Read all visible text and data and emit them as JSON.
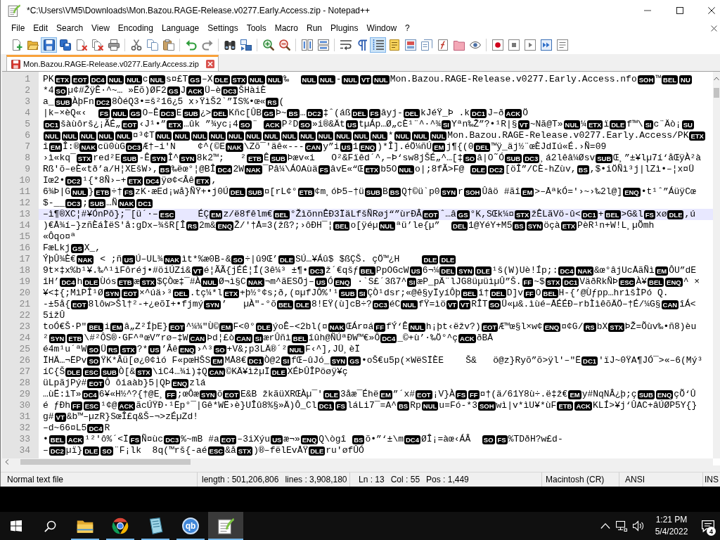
{
  "window": {
    "title": "*C:\\Users\\VM5\\Downloads\\Mon.Bazou.RAGE-Release.v0277.Early.Access.zip - Notepad++"
  },
  "menu": [
    "File",
    "Edit",
    "Search",
    "View",
    "Encoding",
    "Language",
    "Settings",
    "Tools",
    "Macro",
    "Run",
    "Plugins",
    "Window",
    "?"
  ],
  "toolbar": [
    {
      "buttons": [
        {
          "kind": "new",
          "pressed": false
        },
        {
          "kind": "open",
          "pressed": false
        },
        {
          "kind": "save",
          "pressed": true
        },
        {
          "kind": "saveall",
          "pressed": false
        },
        {
          "kind": "close",
          "pressed": false
        },
        {
          "kind": "closeall",
          "pressed": false
        },
        {
          "kind": "print",
          "pressed": false
        }
      ]
    },
    {
      "buttons": [
        {
          "kind": "cut",
          "pressed": false
        },
        {
          "kind": "copy",
          "pressed": false
        },
        {
          "kind": "paste",
          "pressed": false
        }
      ]
    },
    {
      "buttons": [
        {
          "kind": "undo",
          "pressed": false
        },
        {
          "kind": "redo",
          "pressed": false
        }
      ]
    },
    {
      "buttons": [
        {
          "kind": "find",
          "pressed": false
        },
        {
          "kind": "replace",
          "pressed": false
        }
      ]
    },
    {
      "buttons": [
        {
          "kind": "zoomin",
          "pressed": false
        },
        {
          "kind": "zoomout",
          "pressed": false
        }
      ]
    },
    {
      "buttons": [
        {
          "kind": "syncv",
          "pressed": false
        },
        {
          "kind": "synch",
          "pressed": false
        }
      ]
    },
    {
      "buttons": [
        {
          "kind": "wrap",
          "pressed": false
        },
        {
          "kind": "allchars",
          "pressed": false
        },
        {
          "kind": "indent",
          "pressed": true
        },
        {
          "kind": "udl",
          "pressed": false
        },
        {
          "kind": "docmap",
          "pressed": false
        },
        {
          "kind": "doclist",
          "pressed": false
        },
        {
          "kind": "funclist",
          "pressed": false
        },
        {
          "kind": "workspace",
          "pressed": false
        },
        {
          "kind": "monitor",
          "pressed": false
        }
      ]
    },
    {
      "buttons": [
        {
          "kind": "record",
          "pressed": false
        },
        {
          "kind": "stop",
          "pressed": false
        },
        {
          "kind": "play",
          "pressed": false
        },
        {
          "kind": "playmulti",
          "pressed": false
        },
        {
          "kind": "savemacro",
          "pressed": false
        }
      ]
    }
  ],
  "tabs": [
    {
      "label": "Mon.Bazou.RAGE-Release.v0277.Early.Access.zip",
      "selected": true,
      "modified": true
    }
  ],
  "editor": {
    "lines": [
      {
        "number": "1",
        "selected": false,
        "parts": [
          {
            "text": "PK"
          },
          {
            "control": "ETX"
          },
          {
            "control": "EOT"
          },
          {
            "control": "DC4"
          },
          {
            "control": "NUL"
          },
          {
            "control": "NUL"
          },
          {
            "text": "c"
          },
          {
            "control": "NUL"
          },
          {
            "text": "s¤£T"
          },
          {
            "control": "GS"
          },
          {
            "text": "–X"
          },
          {
            "control": "DLE"
          },
          {
            "control": "STX"
          },
          {
            "control": "NUL"
          },
          {
            "control": "NUL"
          },
          {
            "text": "‰  "
          },
          {
            "control": "NUL"
          },
          {
            "control": "NUL"
          },
          {
            "text": "-"
          },
          {
            "control": "NUL"
          },
          {
            "control": "VT"
          },
          {
            "control": "NUL"
          },
          {
            "text": "Mon.Bazou.RAGE-Release.v0277.Early.Access.nfo"
          },
          {
            "control": "SOH"
          },
          {
            "text": "™"
          },
          {
            "control": "BEL"
          },
          {
            "control": "NU"
          }
        ]
      },
      {
        "number": "2",
        "selected": false,
        "parts": [
          {
            "text": "*4"
          },
          {
            "control": "SO"
          },
          {
            "text": "µ¢#ŽÿÊ·^~… »Ëõ)ØF2"
          },
          {
            "control": "GS"
          },
          {
            "text": "J"
          },
          {
            "control": "ACK"
          },
          {
            "text": "Ü–è"
          },
          {
            "control": "DC3"
          },
          {
            "text": "ŠHàiÈ"
          }
        ]
      },
      {
        "number": "3",
        "selected": false,
        "parts": [
          {
            "text": "a_"
          },
          {
            "control": "SUB"
          },
          {
            "text": "ÀþFn"
          },
          {
            "control": "DC2"
          },
          {
            "text": "8ÒéQ3•=š²16¿5 x›ŸìŠ2`”ÏS%•œ«"
          },
          {
            "control": "RS"
          },
          {
            "text": "("
          }
        ]
      },
      {
        "number": "4",
        "selected": false,
        "parts": [
          {
            "text": "|k–×èQ«‹  "
          },
          {
            "control": "FS"
          },
          {
            "control": "NUL"
          },
          {
            "control": "GS"
          },
          {
            "text": "O–Ê"
          },
          {
            "control": "DC3"
          },
          {
            "text": "E"
          },
          {
            "control": "SUB"
          },
          {
            "text": "¿>"
          },
          {
            "control": "DEL"
          },
          {
            "text": "Kñc[ÛB"
          },
          {
            "control": "GS"
          },
          {
            "text": "Þ~"
          },
          {
            "control": "BS"
          },
          {
            "text": "…"
          },
          {
            "control": "DC2"
          },
          {
            "text": "‡ˆ(áß"
          },
          {
            "control": "DEL"
          },
          {
            "control": "FS"
          },
          {
            "text": "âyj-"
          },
          {
            "control": "DEL"
          },
          {
            "text": "kJéŸ_Þ .k"
          },
          {
            "control": "DC1"
          },
          {
            "text": "J–ð"
          },
          {
            "control": "ACK"
          },
          {
            "text": "Ö"
          }
        ]
      },
      {
        "number": "5",
        "selected": false,
        "parts": [
          {
            "control": "DC1"
          },
          {
            "text": "šàùôrš¿¡ÃÉ„"
          },
          {
            "control": "EOT"
          },
          {
            "text": "‹J¹•”"
          },
          {
            "control": "ETX"
          },
          {
            "text": "…ûk ”¾yc¡4"
          },
          {
            "control": "SO"
          },
          {
            "text": "¨ "
          },
          {
            "control": "ACK"
          },
          {
            "text": "P²D"
          },
          {
            "control": "SO"
          },
          {
            "text": "»i®&Ät"
          },
          {
            "control": "US"
          },
          {
            "text": "tµÁp…Ø„cÈ¹¨^·^¾"
          },
          {
            "control": "SI"
          },
          {
            "text": "Yªn‰Ž”?•¹R|§"
          },
          {
            "control": "VT"
          },
          {
            "text": "~Nã@T»"
          },
          {
            "control": "NUL"
          },
          {
            "text": "¼"
          },
          {
            "control": "ETX"
          },
          {
            "text": "ï"
          },
          {
            "control": "DLE"
          },
          {
            "text": "f™\\"
          },
          {
            "control": "SI"
          },
          {
            "text": "c¨Äò¡"
          },
          {
            "control": "SU"
          }
        ]
      },
      {
        "number": "6",
        "selected": false,
        "parts": [
          {
            "control": "NUL"
          },
          {
            "control": "NUL"
          },
          {
            "control": "NUL"
          },
          {
            "control": "NUL"
          },
          {
            "control": "NUL"
          },
          {
            "text": "¤³¢T"
          },
          {
            "control": "NUL"
          },
          {
            "control": "NUL"
          },
          {
            "control": "NUL"
          },
          {
            "control": "NUL"
          },
          {
            "control": "NUL"
          },
          {
            "control": "NUL"
          },
          {
            "control": "NUL"
          },
          {
            "control": "NUL"
          },
          {
            "control": "NUL"
          },
          {
            "control": "NUL"
          },
          {
            "control": "NUL"
          },
          {
            "control": "NUL"
          },
          {
            "control": "NUL"
          },
          {
            "text": "*"
          },
          {
            "control": "NUL"
          },
          {
            "control": "NUL"
          },
          {
            "control": "NUL"
          },
          {
            "text": "Mon.Bazou.RAGE-Release.v0277.Early.Access/PK"
          },
          {
            "control": "ETX"
          }
        ]
      },
      {
        "number": "7",
        "selected": false,
        "parts": [
          {
            "text": "î"
          },
          {
            "control": "EM"
          },
          {
            "text": "Î:®"
          },
          {
            "control": "NAK"
          },
          {
            "text": "cü0ùG"
          },
          {
            "control": "DC3"
          },
          {
            "text": "Æ†–i'N    ¢^(©E"
          },
          {
            "control": "NAK"
          },
          {
            "text": "\\Zõ¯'äê«---"
          },
          {
            "control": "CAN"
          },
          {
            "text": "y”i"
          },
          {
            "control": "US"
          },
          {
            "text": "1"
          },
          {
            "control": "ENQ"
          },
          {
            "text": ")*Î].éÖ¼ñÚ"
          },
          {
            "control": "EM"
          },
          {
            "text": "j¶{(0"
          },
          {
            "control": "DEL"
          },
          {
            "text": "™ÿ_äj½¨œÈJdIú«É.›Ñ=09"
          }
        ]
      },
      {
        "number": "8",
        "selected": false,
        "parts": [
          {
            "text": "›ì«kq¯"
          },
          {
            "control": "STX"
          },
          {
            "text": "red²E"
          },
          {
            "control": "SUB"
          },
          {
            "text": "-Ê"
          },
          {
            "control": "SYN"
          },
          {
            "text": "Î^"
          },
          {
            "control": "SYN"
          },
          {
            "text": "8k2™;   ²"
          },
          {
            "control": "ETB"
          },
          {
            "text": "Ê"
          },
          {
            "control": "SUB"
          },
          {
            "text": "Þæv«i   O²&Fïêd´^,–Þ‘sw8jŠÉ„^…[‡"
          },
          {
            "control": "SO"
          },
          {
            "text": "â|O˜Ó"
          },
          {
            "control": "SUB"
          },
          {
            "control": "DC3"
          },
          {
            "text": "¸á2lêâ¼Øsv"
          },
          {
            "control": "SUB"
          },
          {
            "text": "Œ¸”±¥lµ7í‘åŒÿÀ²à"
          }
        ]
      },
      {
        "number": "9",
        "selected": false,
        "parts": [
          {
            "text": "Rß'õ–eÈ«tð’a/H¦XEšW›,"
          },
          {
            "control": "BS"
          },
          {
            "text": "‰ëœ°¦@BÎ"
          },
          {
            "control": "DC4"
          },
          {
            "text": "2W"
          },
          {
            "control": "NAK"
          },
          {
            "text": "¯Pâ¼\\ÁOAùä"
          },
          {
            "control": "FS"
          },
          {
            "text": "âvE«“Œ"
          },
          {
            "control": "ETX"
          },
          {
            "text": "b5O"
          },
          {
            "control": "NUL"
          },
          {
            "text": "o|;8fÃ>F@ "
          },
          {
            "control": "DLE"
          },
          {
            "control": "DC2"
          },
          {
            "text": "[öÎ”/CÈ-hZùv,"
          },
          {
            "control": "BS"
          },
          {
            "text": ",$•iÖÑì³j|lZì•–¦x¤Ü"
          }
        ]
      },
      {
        "number": "10",
        "selected": false,
        "parts": [
          {
            "text": "Iœ2•"
          },
          {
            "control": "DC2"
          },
          {
            "text": "¹{*8Ñ›–+"
          },
          {
            "control": "ETX"
          },
          {
            "control": "DC4"
          },
          {
            "text": "ÿø¢<Âê"
          },
          {
            "control": "ETX"
          },
          {
            "text": ","
          }
        ]
      },
      {
        "number": "11",
        "selected": false,
        "parts": [
          {
            "text": "6¾Þ|G"
          },
          {
            "control": "NUL"
          },
          {
            "text": "}"
          },
          {
            "control": "ETB"
          },
          {
            "text": "÷†"
          },
          {
            "control": "FS"
          },
          {
            "text": "zK·æEd¡wå}ÑŸ+•j0Ú"
          },
          {
            "control": "DEL"
          },
          {
            "control": "SUB"
          },
          {
            "text": "¤[rL¢°"
          },
          {
            "control": "ETB"
          },
          {
            "text": "¢m¸óÞ5–†ü"
          },
          {
            "control": "SUB"
          },
          {
            "text": "B"
          },
          {
            "control": "BS"
          },
          {
            "text": "Q†©ü`p0"
          },
          {
            "control": "SYN"
          },
          {
            "text": "r"
          },
          {
            "control": "SOH"
          },
          {
            "text": "Ûâö #ãî"
          },
          {
            "control": "EM"
          },
          {
            "text": ">–ÅªkÓ='›~›‰2l@]"
          },
          {
            "control": "ENQ"
          },
          {
            "text": "•t¹ˆ”ÁüÿCœ"
          }
        ]
      },
      {
        "number": "12",
        "selected": false,
        "parts": [
          {
            "text": "$-__"
          },
          {
            "control": "DC3"
          },
          {
            "text": ";"
          },
          {
            "control": "SUB"
          },
          {
            "text": "…Ñ"
          },
          {
            "control": "NAK"
          },
          {
            "control": "DC1"
          }
        ]
      },
      {
        "number": "13",
        "selected": true,
        "parts": [
          {
            "text": "–ì¶®XC¦#¥ÓnPô};¯[ü´·–"
          },
          {
            "control": "ESC"
          },
          {
            "text": "    ÉÇ"
          },
          {
            "control": "EM"
          },
          {
            "text": "z/ë8fêlm€"
          },
          {
            "control": "BEL"
          },
          {
            "text": "°ŽìõnnÊÐ3ÏäLfšÑRøj“”ùrÐÂ"
          },
          {
            "control": "EOT"
          },
          {
            "text": "ˆ…â"
          },
          {
            "control": "GS"
          },
          {
            "text": "°K,SŒk¼¤"
          },
          {
            "control": "STX"
          },
          {
            "text": "žÊLãVö-û<"
          },
          {
            "control": "DC1"
          },
          {
            "text": "+"
          },
          {
            "control": "BEL"
          },
          {
            "text": ">G&l"
          },
          {
            "control": "FS"
          },
          {
            "text": "xø"
          },
          {
            "control": "DLE"
          },
          {
            "text": ",ú"
          }
        ]
      },
      {
        "number": "14",
        "selected": false,
        "parts": [
          {
            "text": ")€Å¾í–}zñÈáÌëS'å:gDx–¾šR[Î"
          },
          {
            "control": "RS"
          },
          {
            "text": "2m&"
          },
          {
            "control": "ENQ"
          },
          {
            "text": "Ž/'†Å=3(žß?;›ôÐH¯¦"
          },
          {
            "control": "BEL"
          },
          {
            "text": "o[ÿéµ"
          },
          {
            "control": "NUL"
          },
          {
            "text": "ªü’le{µ”  "
          },
          {
            "control": "DEL"
          },
          {
            "text": "1@YéY+M5"
          },
          {
            "control": "BS"
          },
          {
            "control": "SYN"
          },
          {
            "text": "öçà"
          },
          {
            "control": "ETX"
          },
          {
            "text": "PèR¹n+W!L¸µÕmh"
          }
        ]
      },
      {
        "number": "15",
        "selected": false,
        "parts": [
          {
            "text": "«Ôqo¤ª"
          }
        ]
      },
      {
        "number": "16",
        "selected": false,
        "parts": [
          {
            "text": "FæLkj"
          },
          {
            "control": "GS"
          },
          {
            "text": "X_,"
          }
        ]
      },
      {
        "number": "17",
        "selected": false,
        "parts": [
          {
            "text": "ÝþÛ¾È€"
          },
          {
            "control": "NAK"
          },
          {
            "text": " < ;ñ"
          },
          {
            "control": "US"
          },
          {
            "text": "Ú–UL¾"
          },
          {
            "control": "NAK"
          },
          {
            "text": "ìt*%æ0B-&"
          },
          {
            "control": "SO"
          },
          {
            "text": "÷|û9Œ’"
          },
          {
            "control": "DLE"
          },
          {
            "text": "SÚ…¥Áû$ $ßÇŠ. çÖ™¿H    "
          },
          {
            "control": "DLE"
          },
          {
            "control": "DLE"
          }
        ]
      },
      {
        "number": "18",
        "selected": false,
        "parts": [
          {
            "text": "9t×‡x%b¹¥.‰^¹ìFôréj•#öiÚZi&"
          },
          {
            "control": "VT"
          },
          {
            "text": "é¦ÃÃ{jÉÉ¦Í(3ê¼³ ±¶•"
          },
          {
            "control": "DC3"
          },
          {
            "text": "ž´€qšƒ"
          },
          {
            "control": "BEL"
          },
          {
            "text": "PpOGcW"
          },
          {
            "control": "US"
          },
          {
            "text": "6¬¼"
          },
          {
            "control": "DEL"
          },
          {
            "control": "SYN"
          },
          {
            "control": "DLE"
          },
          {
            "text": "¹š(W)Uè!Íp;:"
          },
          {
            "control": "DC4"
          },
          {
            "control": "NAK"
          },
          {
            "text": "&œ°âjUcÅãÑì"
          },
          {
            "control": "EM"
          },
          {
            "text": "ÔU”dE"
          }
        ]
      },
      {
        "number": "19",
        "selected": false,
        "parts": [
          {
            "text": "îH’"
          },
          {
            "control": "DC4"
          },
          {
            "text": "h"
          },
          {
            "control": "DLE"
          },
          {
            "text": "Ùós"
          },
          {
            "control": "ETB"
          },
          {
            "text": "æ"
          },
          {
            "control": "STX"
          },
          {
            "text": "$ÇÒœ‡¯#À"
          },
          {
            "control": "NUL"
          },
          {
            "text": "Ø¬ì§C"
          },
          {
            "control": "NAK"
          },
          {
            "text": "¬m^ãESÖj–"
          },
          {
            "control": "US"
          },
          {
            "text": "Ó"
          },
          {
            "control": "ENQ"
          },
          {
            "text": " ·`S£´3ß7^"
          },
          {
            "control": "SI"
          },
          {
            "text": "æP_pÄ¨lJG8üµüìµÛ”Š."
          },
          {
            "control": "FF"
          },
          {
            "text": "~$"
          },
          {
            "control": "STX"
          },
          {
            "control": "DC1"
          },
          {
            "text": "VäðRkÑÞ"
          },
          {
            "control": "ESC"
          },
          {
            "text": "À¥"
          },
          {
            "control": "BEL"
          },
          {
            "control": "ENQ"
          },
          {
            "text": "^ ×"
          }
        ]
      },
      {
        "number": "20",
        "selected": false,
        "parts": [
          {
            "text": "¥<‡{;MìPÎ¹Ø"
          },
          {
            "control": "SYN"
          },
          {
            "control": "EOT"
          },
          {
            "text": "×^úä›³"
          },
          {
            "control": "DEL"
          },
          {
            "text": ".tç¼*l"
          },
          {
            "control": "ETX"
          },
          {
            "text": "+þ½°¢s;ð,(¤µfJÔ%'¹"
          },
          {
            "control": "SUB"
          },
          {
            "control": "SI"
          },
          {
            "text": "ÇÒ¹dsr;«@ê§yÏyíÔþ"
          },
          {
            "control": "BEL"
          },
          {
            "text": "î†"
          },
          {
            "control": "DEL"
          },
          {
            "text": "D]v"
          },
          {
            "control": "FF"
          },
          {
            "text": "O"
          },
          {
            "control": "BEL"
          },
          {
            "text": "H-{’@Ùƒpp…hrìšÌPó Q."
          }
        ]
      },
      {
        "number": "21",
        "selected": false,
        "parts": [
          {
            "text": "-±5å{"
          },
          {
            "control": "EOT"
          },
          {
            "text": "8lôw>Šl†²-+¿eõI+•fjmý"
          },
          {
            "control": "SYN"
          },
          {
            "text": "’   µÀ\"-°õ"
          },
          {
            "control": "BEL"
          },
          {
            "control": "DLE"
          },
          {
            "text": "8!EŸ(ù]cB÷?"
          },
          {
            "control": "DC3"
          },
          {
            "text": "éC"
          },
          {
            "control": "NUL"
          },
          {
            "text": "fŸ=ìö"
          },
          {
            "control": "VT"
          },
          {
            "control": "VT"
          },
          {
            "text": "RÎT"
          },
          {
            "control": "SO"
          },
          {
            "text": "Ü«µ&.ìùé–ÅÉÉÐ–rbÌìêõÄÖ–†É/¼G§"
          },
          {
            "control": "CAN"
          },
          {
            "text": "îÁ<"
          }
        ]
      },
      {
        "number": "22",
        "selected": false,
        "parts": [
          {
            "text": "5ižÛ"
          }
        ]
      },
      {
        "number": "23",
        "selected": false,
        "parts": [
          {
            "text": "toÓ€Š·P\""
          },
          {
            "control": "BEL"
          },
          {
            "text": "i"
          },
          {
            "control": "EM"
          },
          {
            "text": "â„Z²ÍþE}"
          },
          {
            "control": "EOT"
          },
          {
            "text": "^¼¾\"Ù©"
          },
          {
            "control": "EM"
          },
          {
            "text": "F<0°"
          },
          {
            "control": "DLE"
          },
          {
            "text": "ýoÊ–<2bl(¤"
          },
          {
            "control": "NAK"
          },
          {
            "text": "ŒÁr¤á"
          },
          {
            "control": "FF"
          },
          {
            "text": "fÝ‘Ê"
          },
          {
            "control": "NUL"
          },
          {
            "text": "h¡þt‹ëžv?)"
          },
          {
            "control": "EOT"
          },
          {
            "text": "Æ™œ§l×w¢"
          },
          {
            "control": "ENQ"
          },
          {
            "text": "¤¢G/"
          },
          {
            "control": "RS"
          },
          {
            "text": "bX"
          },
          {
            "control": "STX"
          },
          {
            "text": "ÞŽ=Õùv‰•ñ8)èu"
          }
        ]
      },
      {
        "number": "24",
        "selected": false,
        "parts": [
          {
            "text": "²"
          },
          {
            "control": "SYN"
          },
          {
            "control": "ETB"
          },
          {
            "text": "\\#²ÔS®·GF^ªœV”rø–‡W"
          },
          {
            "control": "CAN"
          },
          {
            "text": "Þd¦£ò"
          },
          {
            "control": "CAN"
          },
          {
            "control": "SI"
          },
          {
            "text": "ærÛñì"
          },
          {
            "control": "BEL"
          },
          {
            "text": "îûh@ÑÚªÐW™€»Ô"
          },
          {
            "control": "DC4"
          },
          {
            "text": "_©+ù’·‰Ö°^ç"
          },
          {
            "control": "ACK"
          },
          {
            "text": "ðBÅ"
          }
        ]
      },
      {
        "number": "25",
        "selected": false,
        "parts": [
          {
            "text": "é4m¹u´ªW"
          },
          {
            "control": "SO"
          },
          {
            "text": "Ü"
          },
          {
            "control": "RS"
          },
          {
            "control": "STX"
          },
          {
            "text": "?*"
          },
          {
            "control": "US"
          },
          {
            "text": "’Âê"
          },
          {
            "control": "ENQ"
          },
          {
            "text": "›^³"
          },
          {
            "control": "SO"
          },
          {
            "text": "+V&;p3LÄ®´²"
          },
          {
            "control": "NUL"
          },
          {
            "text": "F‹^],JÜ¸èÏ"
          }
        ]
      },
      {
        "number": "26",
        "selected": false,
        "parts": [
          {
            "text": "ÏHÄ…¬ËPv"
          },
          {
            "control": "SO"
          },
          {
            "text": "ŸK*Âü[ø¿0¢ìó F«pœHŠS"
          },
          {
            "control": "EM"
          },
          {
            "text": "MÅ8€"
          },
          {
            "control": "DC1"
          },
          {
            "text": "Ò@2"
          },
          {
            "control": "SI"
          },
          {
            "text": "fŒ–ûJó_"
          },
          {
            "control": "SYN"
          },
          {
            "control": "GS"
          },
          {
            "text": "•oŠ€u5p(×WëSÏÈE    Š&   ö@z}Ryõ”õ>ÿl'–\"Ë"
          },
          {
            "control": "DC1"
          },
          {
            "text": "'ïJ~0ŸA¶JÓ¯>«–6(Mý³"
          }
        ]
      },
      {
        "number": "27",
        "selected": false,
        "parts": [
          {
            "text": "íC{Š"
          },
          {
            "control": "DLE"
          },
          {
            "control": "ESC"
          },
          {
            "control": "SUB"
          },
          {
            "text": "Ò[&"
          },
          {
            "control": "STX"
          },
          {
            "text": "\\iC4…¾i)‡Q"
          },
          {
            "control": "CAN"
          },
          {
            "text": "©KÄ¥ìžµÏ"
          },
          {
            "control": "DLE"
          },
          {
            "text": "XÉÞÛÎPöøÿ¥ç"
          }
        ]
      },
      {
        "number": "28",
        "selected": false,
        "parts": [
          {
            "text": "üLpãjPý#"
          },
          {
            "control": "EOT"
          },
          {
            "text": "Ô ôiaàb}5|QÞ"
          },
          {
            "control": "ENQ"
          },
          {
            "text": "zlá"
          }
        ]
      },
      {
        "number": "29",
        "selected": false,
        "parts": [
          {
            "text": "…ùË:ìT»"
          },
          {
            "control": "DC4"
          },
          {
            "text": "6¥«H½^?{†@E¸"
          },
          {
            "control": "FF"
          },
          {
            "text": ";œÔæ"
          },
          {
            "control": "SYN"
          },
          {
            "text": "õ"
          },
          {
            "control": "EOT"
          },
          {
            "text": "E&B žkãüXRŒÀµ¯'"
          },
          {
            "control": "DLE"
          },
          {
            "text": "3åæ¯Éhë"
          },
          {
            "control": "EM"
          },
          {
            "text": "”´x#"
          },
          {
            "control": "EOT"
          },
          {
            "text": "¡V}À"
          },
          {
            "control": "FS"
          },
          {
            "control": "FF"
          },
          {
            "text": "¤†(ä/61Y8ù÷.ë‡ž€"
          },
          {
            "control": "EM"
          },
          {
            "text": "y#NqNÂ"
          },
          {
            "text": "¿þ;ç"
          },
          {
            "control": "SUB"
          },
          {
            "control": "ENQ"
          },
          {
            "text": "çÕ‘Û"
          }
        ]
      },
      {
        "number": "30",
        "selected": false,
        "parts": [
          {
            "text": "é ƒÐh"
          },
          {
            "control": "FF"
          },
          {
            "control": "ESC"
          },
          {
            "text": "¹¢@"
          },
          {
            "control": "ACK"
          },
          {
            "text": "ãcÚŸÐ·¹Ëp°¯|Gê*WË›è}UÎû8%§»Ä)Ô_Cl"
          },
          {
            "control": "DC1"
          },
          {
            "control": "FS"
          },
          {
            "text": "láLi7¯=A^"
          },
          {
            "control": "BS"
          },
          {
            "text": "Rp"
          },
          {
            "control": "NUL"
          },
          {
            "text": "u=Fó-*3"
          },
          {
            "control": "SOH"
          },
          {
            "text": "wì|v*ìU¥*ùF"
          },
          {
            "control": "ETB"
          },
          {
            "control": "ACK"
          },
          {
            "text": "KLÍ>¥j‘ÛAC+âÚØP5Y{}"
          }
        ]
      },
      {
        "number": "31",
        "selected": false,
        "parts": [
          {
            "text": "g#"
          },
          {
            "control": "VT"
          },
          {
            "text": "&b™–µzR}SœÎ£q&Š–¬>zÉµZd!"
          }
        ]
      },
      {
        "number": "32",
        "selected": false,
        "parts": [
          {
            "text": "–d~66¤L5"
          },
          {
            "control": "DC4"
          },
          {
            "text": "R"
          }
        ]
      },
      {
        "number": "33",
        "selected": false,
        "parts": [
          {
            "text": "•"
          },
          {
            "control": "BEL"
          },
          {
            "control": "ACK"
          },
          {
            "text": "¹²'ô%´<Ï"
          },
          {
            "control": "FS"
          },
          {
            "text": "Ñ¤ùc"
          },
          {
            "control": "DC3"
          },
          {
            "text": "%~mB #a"
          },
          {
            "control": "EOT"
          },
          {
            "text": "–3iXýu"
          },
          {
            "control": "US"
          },
          {
            "text": "æ¬»"
          },
          {
            "control": "ENQ"
          },
          {
            "text": "Q\\ògî "
          },
          {
            "control": "BS"
          },
          {
            "text": "õ•”‘±\\m"
          },
          {
            "control": "DC4"
          },
          {
            "text": "ØÎ¡=àœ‹ÁÂ  "
          },
          {
            "control": "SO"
          },
          {
            "control": "FS"
          },
          {
            "text": "%TDðH?w£d-"
          }
        ]
      },
      {
        "number": "34",
        "selected": false,
        "parts": [
          {
            "text": "–"
          },
          {
            "control": "DC2"
          },
          {
            "text": "µï}"
          },
          {
            "control": "DLE"
          },
          {
            "control": "SO"
          },
          {
            "text": "¨F¡lk  8q(™rš{-aé"
          },
          {
            "control": "ESC"
          },
          {
            "text": "&å"
          },
          {
            "control": "STX"
          },
          {
            "text": ")®–fëlEvÅŸ"
          },
          {
            "control": "DLE"
          },
          {
            "text": "ru'øfÛÓ"
          }
        ]
      }
    ]
  },
  "status_bar": {
    "doc_type": "Normal text file",
    "length": "length : 501,206,806",
    "lines": "lines : 3,908,180",
    "line": "Ln : 13",
    "column": "Col : 55",
    "position": "Pos : 1,449",
    "eol": "Macintosh (CR)",
    "encoding": "ANSI",
    "mode": "INS"
  },
  "taskbar": {
    "apps": [
      {
        "kind": "folder",
        "running": true,
        "selected": false
      },
      {
        "kind": "browser",
        "running": true,
        "selected": false
      },
      {
        "kind": "notebook",
        "running": true,
        "selected": false
      },
      {
        "kind": "letters",
        "text": "qb",
        "running": true,
        "selected": false
      },
      {
        "kind": "editor",
        "running": true,
        "selected": true
      }
    ],
    "clock": {
      "time": "1:21 PM",
      "date": "5/4/2022"
    },
    "notifications": "4"
  }
}
